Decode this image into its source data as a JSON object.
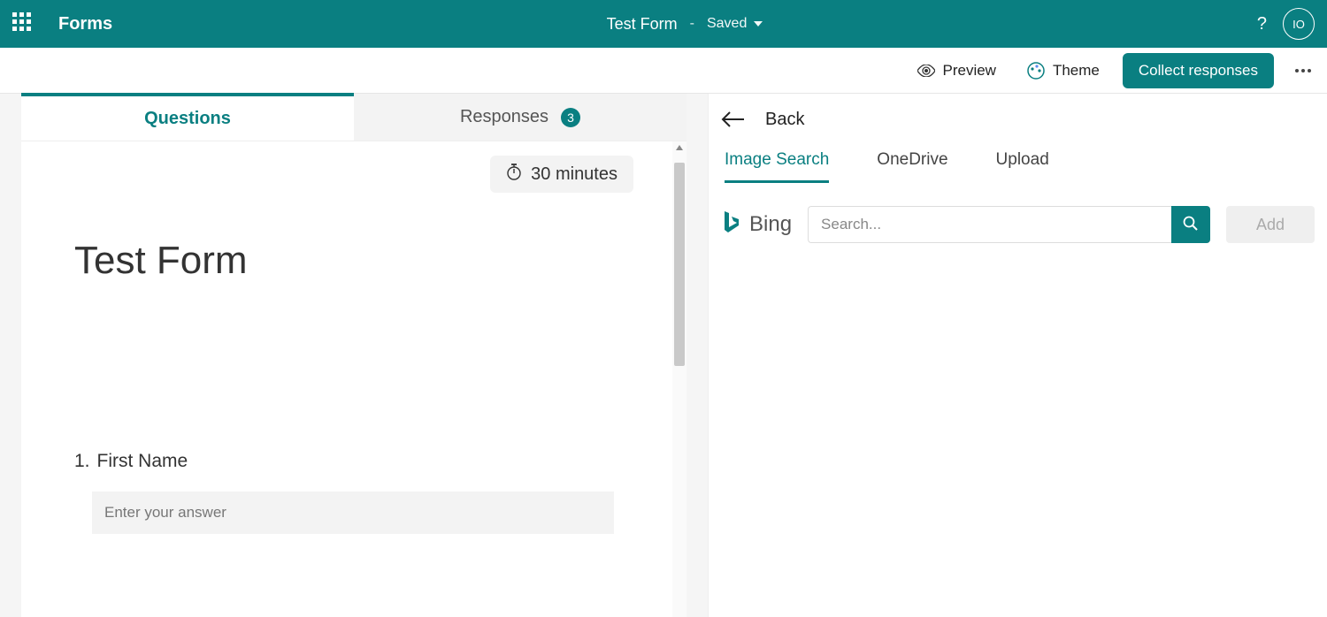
{
  "header": {
    "brand": "Forms",
    "doc_title": "Test Form",
    "separator": "-",
    "save_status": "Saved",
    "avatar_initials": "IO"
  },
  "toolbar": {
    "preview": "Preview",
    "theme": "Theme",
    "collect": "Collect responses"
  },
  "tabs": {
    "questions": "Questions",
    "responses": "Responses",
    "responses_count": "3"
  },
  "form": {
    "timer_text": "30 minutes",
    "title": "Test Form",
    "q1_number": "1.",
    "q1_label": "First Name",
    "q1_placeholder": "Enter your answer"
  },
  "panel": {
    "back": "Back",
    "tabs": {
      "image_search": "Image Search",
      "onedrive": "OneDrive",
      "upload": "Upload"
    },
    "bing_label": "Bing",
    "search_placeholder": "Search...",
    "add_label": "Add"
  }
}
